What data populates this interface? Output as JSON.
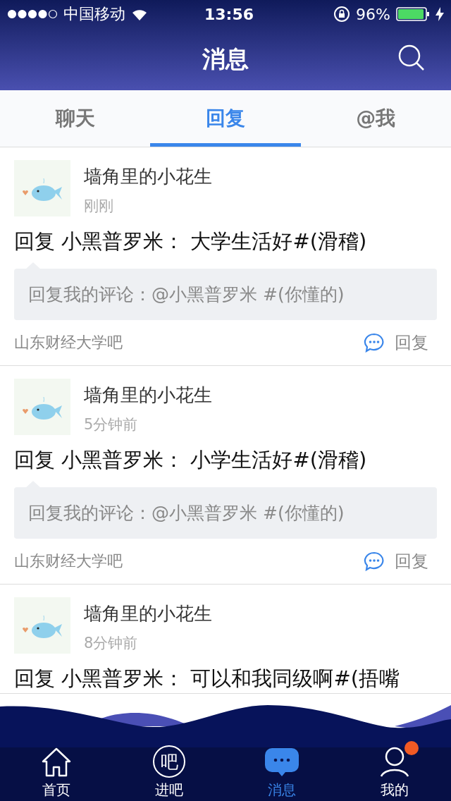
{
  "status_bar": {
    "carrier": "中国移动",
    "time": "13:56",
    "battery": "96%"
  },
  "header": {
    "title": "消息"
  },
  "tabs": [
    {
      "label": "聊天",
      "selected": false
    },
    {
      "label": "回复",
      "selected": true
    },
    {
      "label": "@我",
      "selected": false
    }
  ],
  "messages": [
    {
      "author": "墙角里的小花生",
      "time": "刚刚",
      "content": "回复 小黑普罗米： 大学生活好#(滑稽)",
      "quote": "回复我的评论：@小黑普罗米 #(你懂的)",
      "forum": "山东财经大学吧",
      "reply_label": "回复"
    },
    {
      "author": "墙角里的小花生",
      "time": "5分钟前",
      "content": "回复 小黑普罗米： 小学生活好#(滑稽)",
      "quote": "回复我的评论：@小黑普罗米 #(你懂的)",
      "forum": "山东财经大学吧",
      "reply_label": "回复"
    },
    {
      "author": "墙角里的小花生",
      "time": "8分钟前",
      "content": "回复 小黑普罗米： 可以和我同级啊#(捂嘴"
    }
  ],
  "tab_bar": [
    {
      "kind": "home",
      "label": "首页",
      "selected": false,
      "badge": false
    },
    {
      "kind": "glyph",
      "glyph": "吧",
      "label": "进吧",
      "selected": false,
      "badge": false
    },
    {
      "kind": "chat",
      "label": "消息",
      "selected": true,
      "badge": false
    },
    {
      "kind": "person",
      "label": "我的",
      "selected": false,
      "badge": true
    }
  ]
}
